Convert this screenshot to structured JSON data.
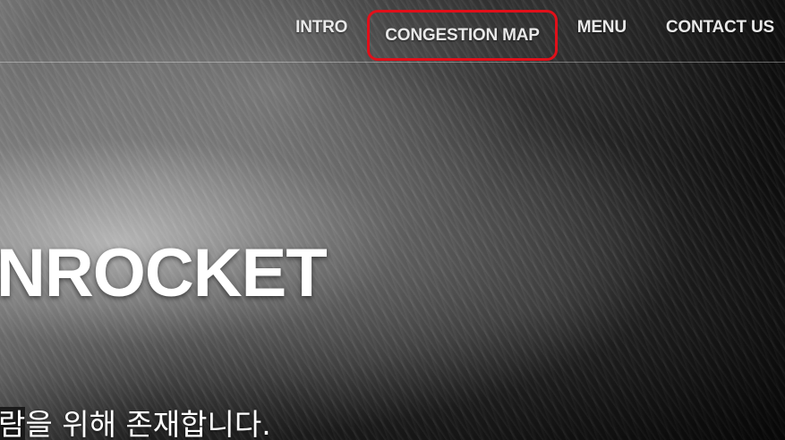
{
  "nav": {
    "items": [
      {
        "label": "INTRO"
      },
      {
        "label": "CONGESTION MAP",
        "highlighted": true
      },
      {
        "label": "MENU"
      },
      {
        "label": "CONTACT US"
      }
    ],
    "highlight_color": "#e0101a"
  },
  "hero": {
    "title": "NROCKET",
    "tagline_selected": "람",
    "tagline_rest": "을 위해 존재합니다."
  },
  "colors": {
    "text": "#ffffff",
    "nav_text": "#e9e9e9"
  }
}
